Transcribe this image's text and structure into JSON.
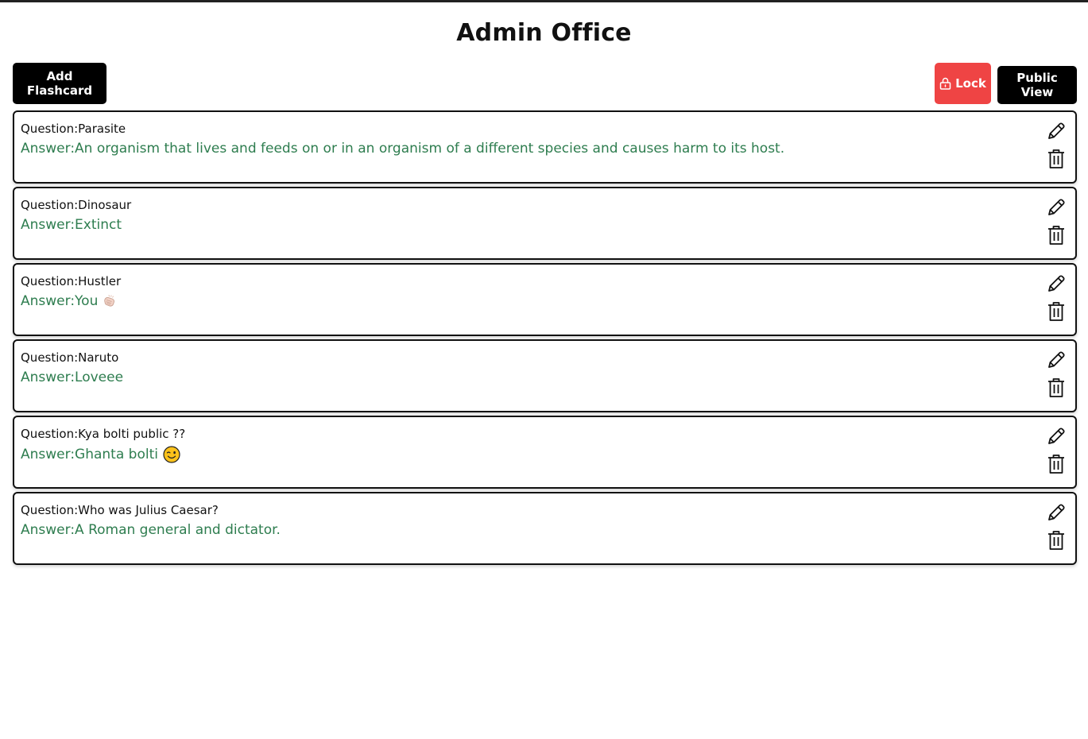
{
  "header": {
    "title": "Admin Office"
  },
  "toolbar": {
    "add_label": "Add Flashcard",
    "lock_label": "Lock",
    "public_label": "Public View"
  },
  "colors": {
    "answer_green": "#2e7d4f",
    "lock_red": "#ef4444",
    "button_black": "#000000"
  },
  "flashcards": [
    {
      "question": "Question:Parasite",
      "answer": "Answer:An organism that lives and feeds on or in an organism of a different species and causes harm to its host.",
      "emoji": ""
    },
    {
      "question": "Question:Dinosaur",
      "answer": "Answer:Extinct",
      "emoji": ""
    },
    {
      "question": "Question:Hustler",
      "answer": "Answer:You",
      "emoji": "clapping-hands-icon"
    },
    {
      "question": "Question:Naruto",
      "answer": "Answer:Loveee",
      "emoji": ""
    },
    {
      "question": "Question:Kya bolti public ??",
      "answer": "Answer:Ghanta bolti",
      "emoji": "winking-face-icon"
    },
    {
      "question": "Question:Who was Julius Caesar?",
      "answer": "Answer:A Roman general and dictator.",
      "emoji": ""
    }
  ],
  "icons": {
    "edit": "pencil-icon",
    "delete": "trash-icon",
    "lock": "lock-icon"
  }
}
